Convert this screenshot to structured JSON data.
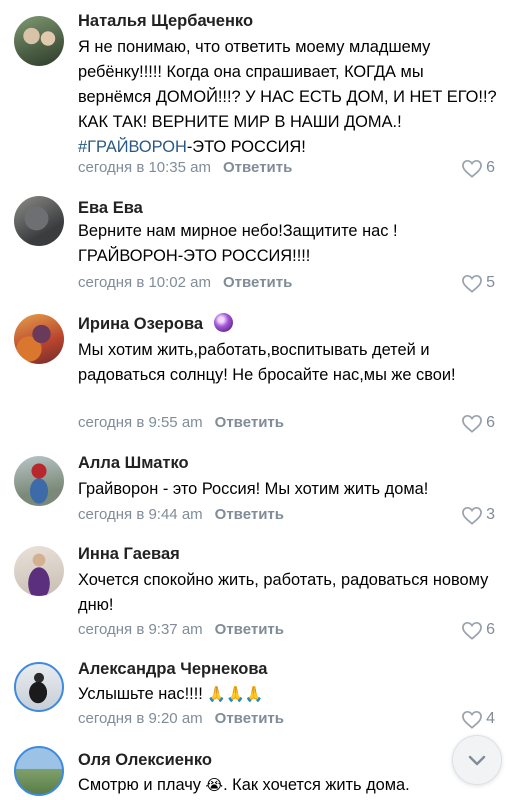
{
  "comments": [
    {
      "name": "Наталья Щербаченко",
      "text_pre": "Я не понимаю, что ответить моему младшему ребёнку!!!!! Когда она спрашивает, КОГДА мы вернёмся ДОМОЙ!!!? У НАС ЕСТЬ ДОМ, И НЕТ ЕГО!!? КАК ТАК! ВЕРНИТЕ МИР В НАШИ ДОМА.! ",
      "hashtag": "#ГРАЙВОРОН",
      "text_post": "-ЭТО РОССИЯ!",
      "time": "сегодня в 10:35 am",
      "reply": "Ответить",
      "likes": "6"
    },
    {
      "name": "Ева Ева",
      "text": "Верните нам мирное небо!Защитите нас ! ГРАЙВОРОН-ЭТО РОССИЯ!!!!",
      "time": "сегодня в 10:02 am",
      "reply": "Ответить",
      "likes": "5"
    },
    {
      "name": "Ирина Озерова",
      "badge_icon": "crystal-ball-emoji",
      "text": "Мы хотим жить,работать,воспитывать детей и радоваться солнцу! Не бросайте нас,мы же свои!",
      "time": "сегодня в 9:55 am",
      "reply": "Ответить",
      "likes": "6"
    },
    {
      "name": "Алла Шматко",
      "text": "Грайворон - это Россия! Мы хотим жить дома!",
      "time": "сегодня в 9:44 am",
      "reply": "Ответить",
      "likes": "3"
    },
    {
      "name": "Инна Гаевая",
      "text": "Хочется спокойно жить, работать, радоваться новому дню!",
      "time": "сегодня в 9:37 am",
      "reply": "Ответить",
      "likes": "6"
    },
    {
      "name": "Александра Чернекова",
      "text": "Услышьте нас!!!!",
      "emoji": "🙏🙏🙏",
      "time": "сегодня в 9:20 am",
      "reply": "Ответить",
      "likes": "4"
    },
    {
      "name": "Оля Олексиенко",
      "text_pre": "Смотрю и плачу ",
      "emoji": "😭",
      "text_post": ". Как хочется жить дома."
    }
  ],
  "icons": {
    "like": "heart-outline-icon",
    "scroll": "chevron-down-icon"
  },
  "colors": {
    "meta": "#818c99",
    "hashtag": "#2a5885",
    "background": "#ffffff"
  }
}
